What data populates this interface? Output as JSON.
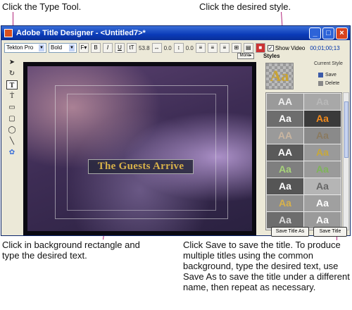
{
  "callouts": {
    "type_tool": "Click the Type Tool.",
    "desired_style": "Click the desired style.",
    "background_rect": "Click in background rectangle and type the desired text.",
    "save": "Click Save to save the title. To produce multiple titles using the common background, type the desired text, use Save As to save the title under a different name, then repeat as necessary."
  },
  "window": {
    "title": "Adobe Title Designer - <Untitled7>*"
  },
  "toolbar": {
    "font": "Tekton Pro",
    "weight": "Bold",
    "size": "53.8",
    "kern": "0.0",
    "lead": "0.0",
    "show_video": "Show Video",
    "timecode": "00;01;00;13"
  },
  "stage": {
    "title_text": "The Guests Arrive",
    "more_label": "More▸"
  },
  "styles": {
    "header": "Styles",
    "current_style": "Current Style",
    "preview": "Aa",
    "save": "Save",
    "delete": "Delete",
    "swatches": [
      "AA",
      "Aa",
      "Aa",
      "Aa",
      "AA",
      "Aa",
      "AA",
      "Aa",
      "Aa",
      "Aa",
      "Aa",
      "Aa",
      "Aa",
      "Aa",
      "Aa",
      "Aa"
    ]
  },
  "buttons": {
    "save_as": "Save Title As",
    "save": "Save Title"
  }
}
